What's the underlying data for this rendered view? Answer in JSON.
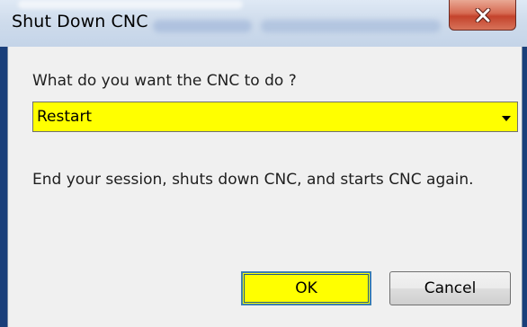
{
  "window": {
    "title": "Shut Down CNC"
  },
  "dialog": {
    "prompt": "What do you want the CNC to do ?",
    "action_select": {
      "selected": "Restart"
    },
    "description": "End your session, shuts down CNC, and starts CNC again."
  },
  "buttons": {
    "ok_label": "OK",
    "cancel_label": "Cancel"
  },
  "icons": {
    "close": "close-icon",
    "dropdown": "chevron-down-icon"
  },
  "colors": {
    "highlight": "#ffff00",
    "close_button": "#c4432c",
    "window_frame": "#1a3f7a"
  }
}
